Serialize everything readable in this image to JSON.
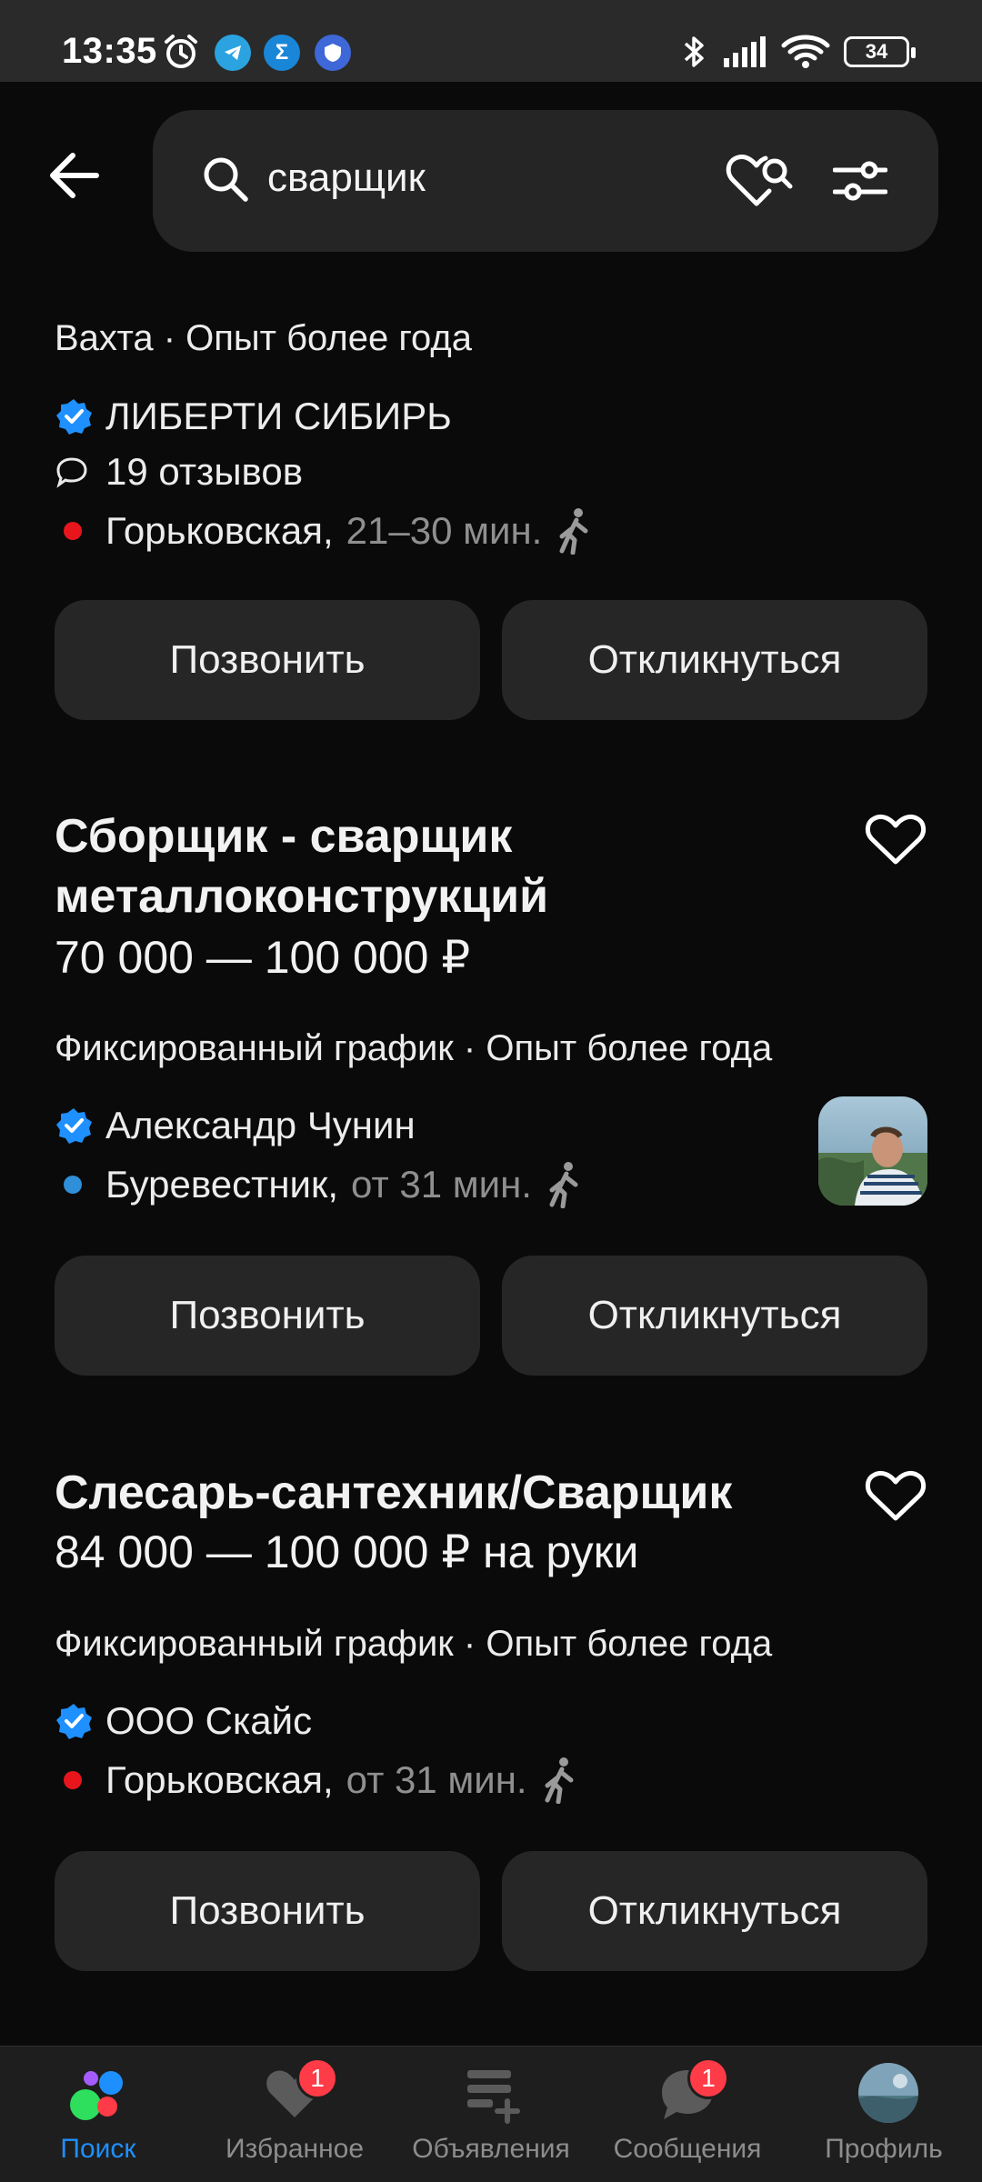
{
  "status_bar": {
    "time": "13:35",
    "battery": "34"
  },
  "header": {
    "search_value": "сварщик"
  },
  "listings": [
    {
      "meta": "Вахта · Опыт более года",
      "employer": "ЛИБЕРТИ СИБИРЬ",
      "reviews": "19 отзывов",
      "metro": "Горьковская,",
      "metro_color": "#e8151d",
      "travel": "21–30 мин.",
      "call_label": "Позвонить",
      "respond_label": "Откликнуться"
    },
    {
      "title_line1": "Сборщик - сварщик",
      "title_line2": "металлоконструкций",
      "salary": "70 000 — 100 000 ₽",
      "meta": "Фиксированный график · Опыт более года",
      "employer": "Александр Чунин",
      "metro": "Буревестник,",
      "metro_color": "#2f8fd8",
      "travel": "от 31 мин.",
      "call_label": "Позвонить",
      "respond_label": "Откликнуться"
    },
    {
      "title_line1": "Слесарь-сантехник/Сварщик",
      "salary": "84 000 — 100 000 ₽ на руки",
      "meta": "Фиксированный график · Опыт более года",
      "employer": "ООО Скайс",
      "metro": "Горьковская,",
      "metro_color": "#e8151d",
      "travel": "от 31 мин.",
      "call_label": "Позвонить",
      "respond_label": "Откликнуться"
    }
  ],
  "bottom_nav": [
    {
      "label": "Поиск",
      "active": true
    },
    {
      "label": "Избранное",
      "badge": "1"
    },
    {
      "label": "Объявления"
    },
    {
      "label": "Сообщения",
      "badge": "1"
    },
    {
      "label": "Профиль"
    }
  ],
  "colors": {
    "accent": "#1e8fff",
    "verified": "#1e90ff",
    "badge": "#ff3b47"
  }
}
